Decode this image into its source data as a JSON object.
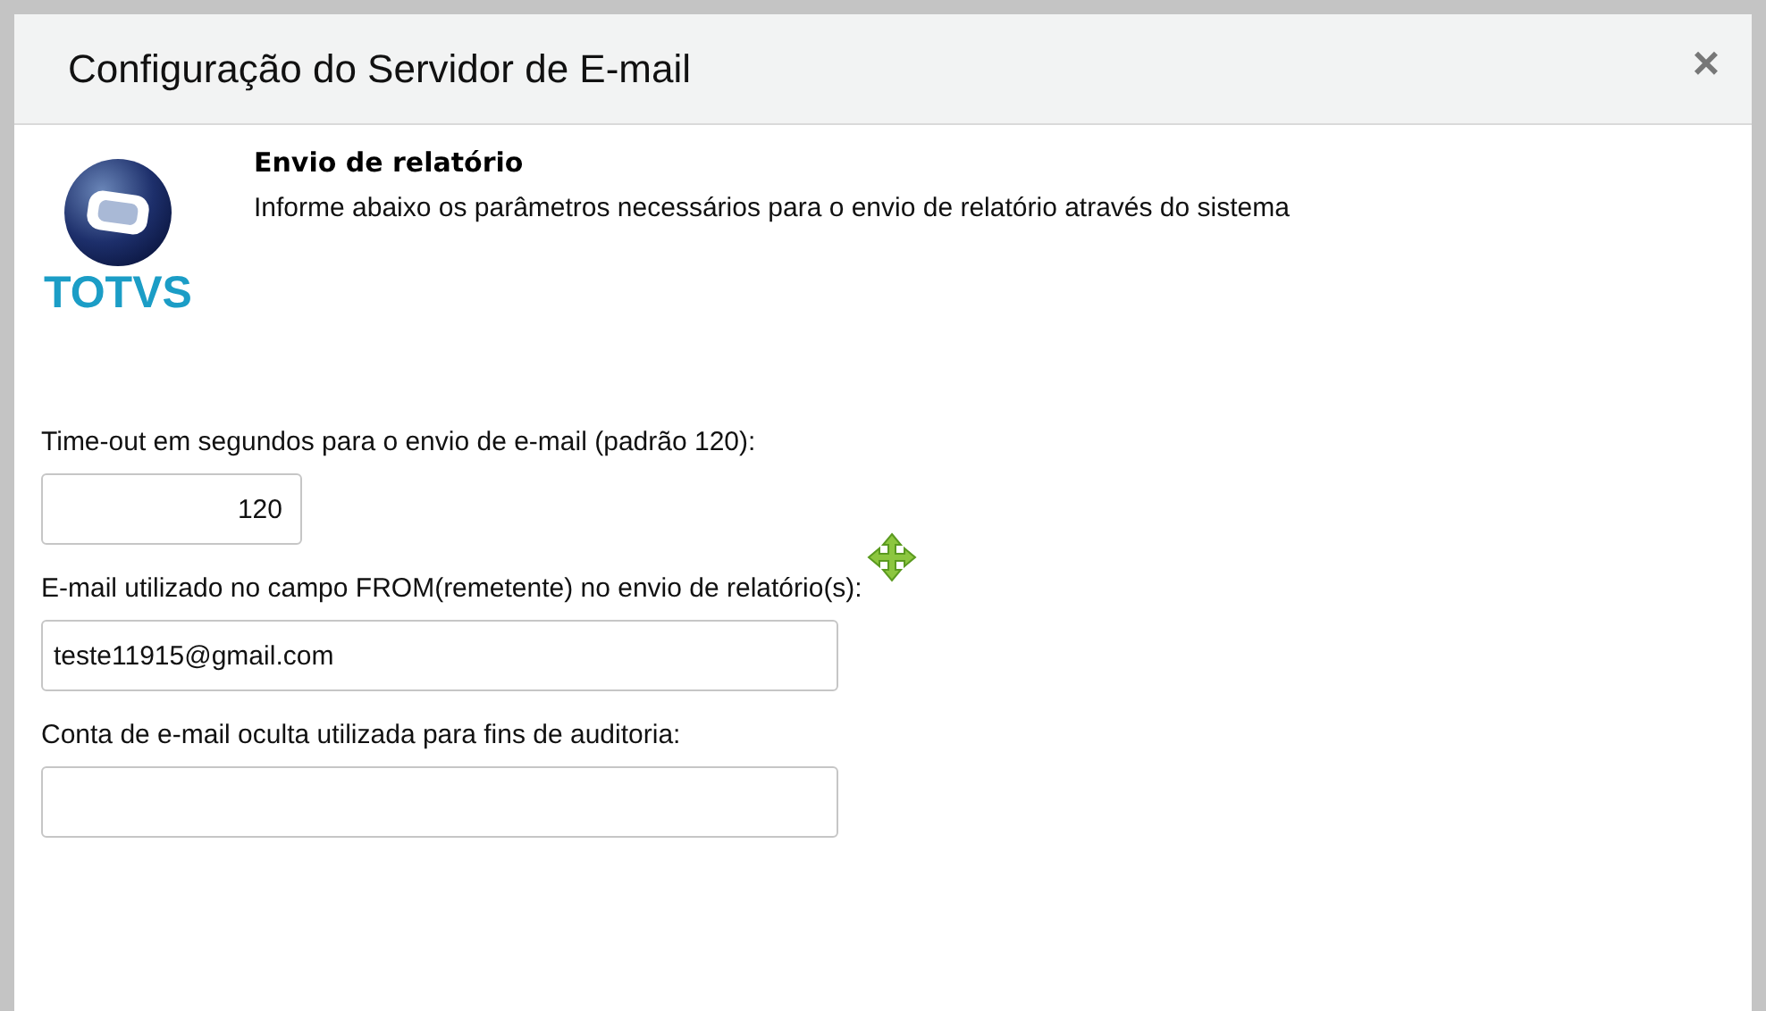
{
  "window": {
    "title": "Configuração do Servidor de E-mail",
    "close": "×"
  },
  "header": {
    "logo_text": "TOTVS",
    "heading": "Envio de relatório",
    "description": "Informe abaixo os parâmetros necessários para o envio de relatório através do sistema"
  },
  "fields": [
    {
      "label": "Time-out em segundos para o envio de e-mail (padrão 120):",
      "kind": "numeric",
      "value": "120"
    },
    {
      "label": "E-mail utilizado no campo FROM(remetente) no envio de relatório(s):",
      "kind": "text",
      "value": "teste11915@gmail.com"
    },
    {
      "label": "Conta de e-mail oculta utilizada para fins de auditoria:",
      "kind": "text"
    }
  ]
}
